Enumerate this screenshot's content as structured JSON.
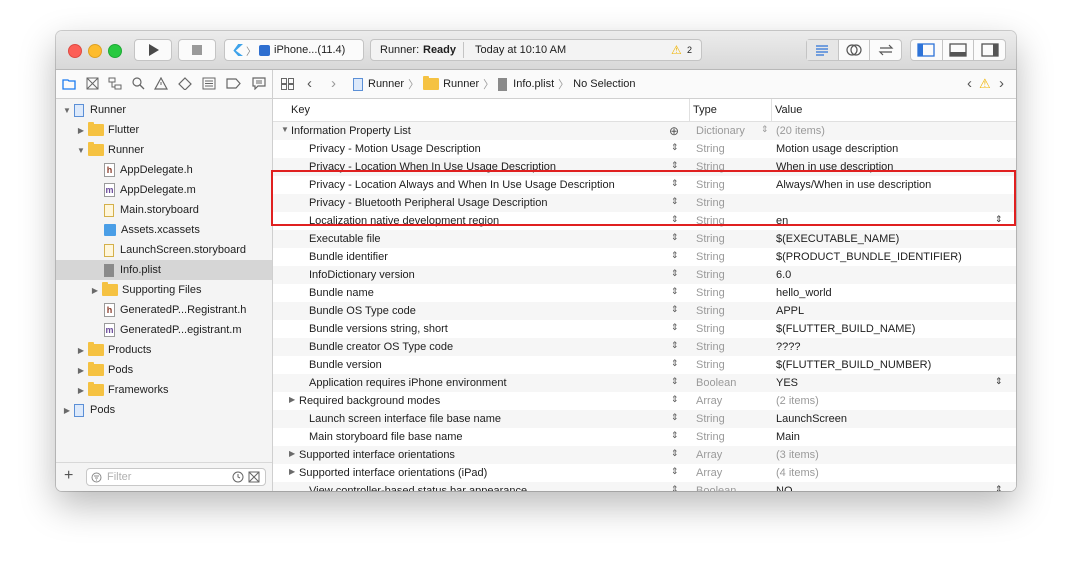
{
  "toolbar": {
    "scheme": "iPhone...(11.4)",
    "status_app": "Runner:",
    "status_state": "Ready",
    "status_time": "Today at 10:10 AM",
    "warning_count": "2"
  },
  "jumpbar": [
    "Runner",
    "Runner",
    "Info.plist",
    "No Selection"
  ],
  "sidebar": {
    "filter_placeholder": "Filter",
    "items": [
      {
        "label": "Runner"
      },
      {
        "label": "Flutter"
      },
      {
        "label": "Runner"
      },
      {
        "label": "AppDelegate.h"
      },
      {
        "label": "AppDelegate.m"
      },
      {
        "label": "Main.storyboard"
      },
      {
        "label": "Assets.xcassets"
      },
      {
        "label": "LaunchScreen.storyboard"
      },
      {
        "label": "Info.plist"
      },
      {
        "label": "Supporting Files"
      },
      {
        "label": "GeneratedP...Registrant.h"
      },
      {
        "label": "GeneratedP...egistrant.m"
      },
      {
        "label": "Products"
      },
      {
        "label": "Pods"
      },
      {
        "label": "Frameworks"
      },
      {
        "label": "Pods"
      }
    ]
  },
  "plist": {
    "columns": {
      "key": "Key",
      "type": "Type",
      "value": "Value"
    },
    "rows": [
      {
        "key": "Information Property List",
        "type": "Dictionary",
        "value": "(20 items)"
      },
      {
        "key": "Privacy - Motion Usage Description",
        "type": "String",
        "value": "Motion usage description"
      },
      {
        "key": "Privacy - Location When In Use Usage Description",
        "type": "String",
        "value": "When in use description"
      },
      {
        "key": "Privacy - Location Always and When In Use Usage Description",
        "type": "String",
        "value": "Always/When in use description"
      },
      {
        "key": "Privacy - Bluetooth Peripheral Usage Description",
        "type": "String",
        "value": ""
      },
      {
        "key": "Localization native development region",
        "type": "String",
        "value": "en"
      },
      {
        "key": "Executable file",
        "type": "String",
        "value": "$(EXECUTABLE_NAME)"
      },
      {
        "key": "Bundle identifier",
        "type": "String",
        "value": "$(PRODUCT_BUNDLE_IDENTIFIER)"
      },
      {
        "key": "InfoDictionary version",
        "type": "String",
        "value": "6.0"
      },
      {
        "key": "Bundle name",
        "type": "String",
        "value": "hello_world"
      },
      {
        "key": "Bundle OS Type code",
        "type": "String",
        "value": "APPL"
      },
      {
        "key": "Bundle versions string, short",
        "type": "String",
        "value": "$(FLUTTER_BUILD_NAME)"
      },
      {
        "key": "Bundle creator OS Type code",
        "type": "String",
        "value": "????"
      },
      {
        "key": "Bundle version",
        "type": "String",
        "value": "$(FLUTTER_BUILD_NUMBER)"
      },
      {
        "key": "Application requires iPhone environment",
        "type": "Boolean",
        "value": "YES"
      },
      {
        "key": "Required background modes",
        "type": "Array",
        "value": "(2 items)"
      },
      {
        "key": "Launch screen interface file base name",
        "type": "String",
        "value": "LaunchScreen"
      },
      {
        "key": "Main storyboard file base name",
        "type": "String",
        "value": "Main"
      },
      {
        "key": "Supported interface orientations",
        "type": "Array",
        "value": "(3 items)"
      },
      {
        "key": "Supported interface orientations (iPad)",
        "type": "Array",
        "value": "(4 items)"
      },
      {
        "key": "View controller-based status bar appearance",
        "type": "Boolean",
        "value": "NO"
      }
    ]
  },
  "colors": {
    "accent": "#1a7bf0",
    "highlight": "#e02020",
    "folder": "#f5c242",
    "warning": "#f0b400"
  }
}
